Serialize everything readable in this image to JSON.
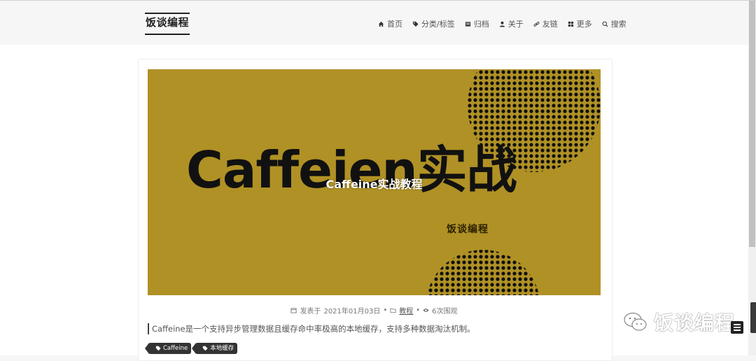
{
  "brand": {
    "name": "饭谈编程"
  },
  "nav": [
    {
      "label": "首页",
      "icon": "home-icon"
    },
    {
      "label": "分类/标签",
      "icon": "tag-icon"
    },
    {
      "label": "归档",
      "icon": "archive-icon"
    },
    {
      "label": "关于",
      "icon": "user-icon"
    },
    {
      "label": "友链",
      "icon": "link-icon"
    },
    {
      "label": "更多",
      "icon": "grid-icon"
    },
    {
      "label": "搜索",
      "icon": "search-icon"
    }
  ],
  "post": {
    "cover_big_text": "Caffeien实战",
    "cover_subtitle": "饭谈编程",
    "title": "Caffeine实战教程",
    "meta_published_label": "发表于",
    "meta_date": "2021年01月03日",
    "meta_category": "教程",
    "meta_views": "6次围观",
    "excerpt": "Caffeine是一个支持异步管理数据且缓存命中率极高的本地缓存，支持多种数据淘汰机制。",
    "tags": [
      "Caffeine",
      "本地缓存"
    ]
  },
  "watermark": {
    "text": "饭谈编程"
  },
  "colors": {
    "cover_bg": "#b09125",
    "tag_bg": "#333333",
    "page_bg": "#ffffff",
    "header_bg": "#f6f6f6"
  }
}
